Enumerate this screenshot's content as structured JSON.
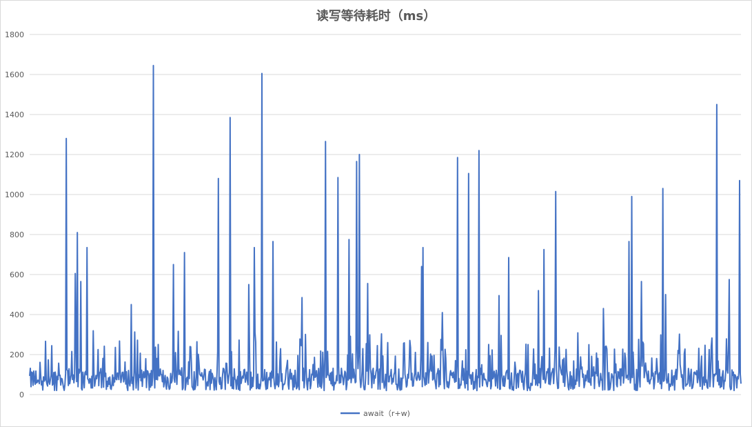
{
  "chart_data": {
    "type": "line",
    "title": "读写等待耗时（ms）",
    "xlabel": "",
    "ylabel": "",
    "ylim": [
      0,
      1800
    ],
    "yticks": [
      0,
      200,
      400,
      600,
      800,
      1000,
      1200,
      1400,
      1600,
      1800
    ],
    "grid": true,
    "legend_position": "bottom",
    "series_color": "#4472C4",
    "n_points": 1030,
    "series": [
      {
        "name": "await（r+w)",
        "baseline_range": [
          20,
          180
        ],
        "spikes": [
          {
            "x": 53,
            "y": 1280
          },
          {
            "x": 66,
            "y": 605
          },
          {
            "x": 69,
            "y": 810
          },
          {
            "x": 74,
            "y": 565
          },
          {
            "x": 83,
            "y": 735
          },
          {
            "x": 147,
            "y": 450
          },
          {
            "x": 179,
            "y": 1645
          },
          {
            "x": 208,
            "y": 650
          },
          {
            "x": 224,
            "y": 710
          },
          {
            "x": 273,
            "y": 1080
          },
          {
            "x": 290,
            "y": 1385
          },
          {
            "x": 317,
            "y": 550
          },
          {
            "x": 325,
            "y": 735
          },
          {
            "x": 336,
            "y": 1605
          },
          {
            "x": 352,
            "y": 765
          },
          {
            "x": 394,
            "y": 485
          },
          {
            "x": 428,
            "y": 1265
          },
          {
            "x": 446,
            "y": 1085
          },
          {
            "x": 462,
            "y": 775
          },
          {
            "x": 473,
            "y": 1165
          },
          {
            "x": 477,
            "y": 1200
          },
          {
            "x": 489,
            "y": 555
          },
          {
            "x": 567,
            "y": 640
          },
          {
            "x": 569,
            "y": 735
          },
          {
            "x": 597,
            "y": 410
          },
          {
            "x": 619,
            "y": 1185
          },
          {
            "x": 635,
            "y": 1105
          },
          {
            "x": 650,
            "y": 1220
          },
          {
            "x": 679,
            "y": 495
          },
          {
            "x": 693,
            "y": 685
          },
          {
            "x": 736,
            "y": 520
          },
          {
            "x": 744,
            "y": 725
          },
          {
            "x": 761,
            "y": 1015
          },
          {
            "x": 830,
            "y": 430
          },
          {
            "x": 867,
            "y": 765
          },
          {
            "x": 871,
            "y": 990
          },
          {
            "x": 885,
            "y": 565
          },
          {
            "x": 916,
            "y": 1030
          },
          {
            "x": 920,
            "y": 500
          },
          {
            "x": 994,
            "y": 1450
          },
          {
            "x": 1012,
            "y": 575
          },
          {
            "x": 1027,
            "y": 1070
          }
        ]
      }
    ]
  }
}
